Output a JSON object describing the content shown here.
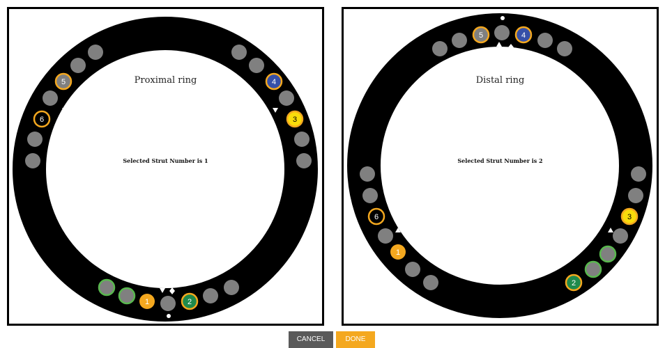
{
  "colors": {
    "ring": "#000000",
    "hole": "#808080",
    "orange": "#f4a81f",
    "green": "#1f8a4c",
    "blue": "#3650a8",
    "yellow": "#f9dc0b",
    "green_outline": "#59b84e",
    "cancel_bg": "#5a5a5a",
    "done_bg": "#f4a81f"
  },
  "proximal": {
    "title": "Proximal ring",
    "selected_text": "Selected Strut Number is 1"
  },
  "distal": {
    "title": "Distal ring",
    "selected_text": "Selected Strut Number is 2"
  },
  "buttons": {
    "cancel": "CANCEL",
    "done": "DONE"
  },
  "struts": {
    "proximal": [
      {
        "label": "1",
        "style": "orange-filled"
      },
      {
        "label": "2",
        "style": "green-filled-orange-outline"
      },
      {
        "label": "3",
        "style": "yellow-filled-orange-outline"
      },
      {
        "label": "4",
        "style": "blue-filled-orange-outline"
      },
      {
        "label": "5",
        "style": "gray-filled-orange-outline"
      },
      {
        "label": "6",
        "style": "black-filled-orange-outline"
      }
    ],
    "distal": [
      {
        "label": "1",
        "style": "orange-filled"
      },
      {
        "label": "2",
        "style": "green-filled-orange-outline"
      },
      {
        "label": "3",
        "style": "yellow-filled-orange-outline"
      },
      {
        "label": "4",
        "style": "blue-filled-orange-outline"
      },
      {
        "label": "5",
        "style": "gray-filled-orange-outline"
      },
      {
        "label": "6",
        "style": "black-filled-orange-outline"
      }
    ]
  }
}
